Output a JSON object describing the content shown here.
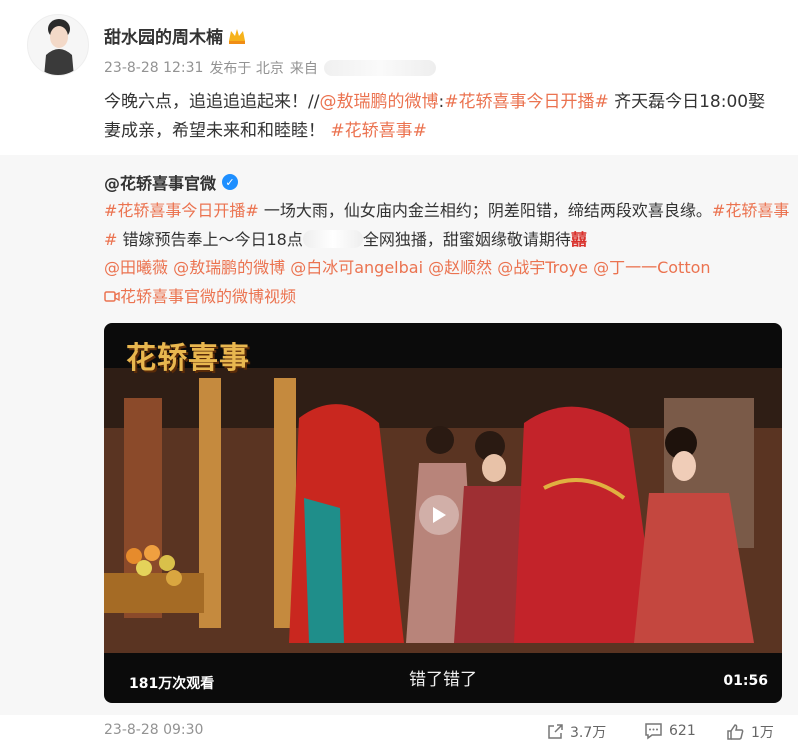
{
  "post": {
    "username": "甜水园的周木楠",
    "meta": {
      "time": "23-8-28 12:31",
      "published_at": "发布于 北京",
      "source": "来自"
    },
    "text": {
      "t1": "今晚六点，追追追追起来！//",
      "mention": "@敖瑞鹏的微博",
      "colon": ":",
      "hashtag1": "#花轿喜事今日开播#",
      "t2": " 齐天磊今日18:00娶妻成亲，希望未来和和睦睦！ ",
      "hashtag2": "#花轿喜事#"
    }
  },
  "quote": {
    "username": "@花轿喜事官微",
    "line1": {
      "hashtag": "#花轿喜事今日开播#",
      "text": " 一场大雨，仙女庙内金兰相约；阴差阳错，缔结两段欢喜良缘。",
      "hashtag2": "#花轿喜事#",
      "text2": " 错嫁预告奉上～今日18点",
      "text3": "全网独播，甜蜜姻缘敬请期待",
      "emoji": "囍"
    },
    "mentions": [
      "@田曦薇",
      "@敖瑞鹏的微博",
      "@白冰可angelbai",
      "@赵顺然",
      "@战宇Troye",
      "@丁一一Cotton"
    ],
    "video_link": "花轿喜事官微的微博视频",
    "video": {
      "title_art": "花轿喜事",
      "subtitle": "错了错了",
      "views": "181万次观看",
      "duration": "01:56"
    },
    "footer": {
      "time": "23-8-28 09:30",
      "shares": "3.7万",
      "comments": "621",
      "likes": "1万"
    }
  },
  "colors": {
    "accent": "#eb7350",
    "verified": "#1e8fff",
    "quote_bg": "#f7f7f7"
  }
}
